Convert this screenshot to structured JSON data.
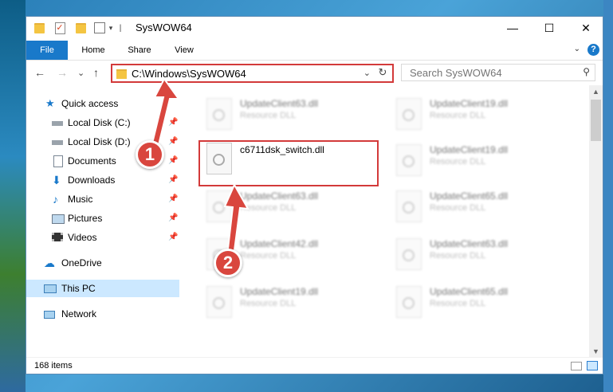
{
  "window": {
    "title": "SysWOW64",
    "minimize": "—",
    "maximize": "☐",
    "close": "✕"
  },
  "ribbon": {
    "tabs": [
      "File",
      "Home",
      "Share",
      "View"
    ],
    "help": "?",
    "expand": "⌄"
  },
  "navbar": {
    "back": "←",
    "forward": "→",
    "recent": "⌄",
    "up": "↑",
    "address": "C:\\Windows\\SysWOW64",
    "address_dropdown": "⌄",
    "refresh": "↻",
    "search_placeholder": "Search SysWOW64",
    "search_icon": "⚲"
  },
  "nav_pane": {
    "items": [
      {
        "label": "Quick access",
        "icon": "star-icon",
        "pinned": false
      },
      {
        "label": "Local Disk (C:)",
        "icon": "drive-icon",
        "pinned": true
      },
      {
        "label": "Local Disk (D:)",
        "icon": "drive-icon",
        "pinned": true
      },
      {
        "label": "Documents",
        "icon": "documents-icon",
        "pinned": true
      },
      {
        "label": "Downloads",
        "icon": "download-icon",
        "pinned": true
      },
      {
        "label": "Music",
        "icon": "music-icon",
        "pinned": true
      },
      {
        "label": "Pictures",
        "icon": "pictures-icon",
        "pinned": true
      },
      {
        "label": "Videos",
        "icon": "videos-icon",
        "pinned": true
      },
      {
        "label": "OneDrive",
        "icon": "cloud-icon",
        "pinned": false
      },
      {
        "label": "This PC",
        "icon": "computer-icon",
        "pinned": false
      },
      {
        "label": "Network",
        "icon": "network-icon",
        "pinned": false
      }
    ],
    "pin_glyph": "📌"
  },
  "files": {
    "highlighted": {
      "name": "c6711dsk_switch.dll"
    },
    "left_column": [
      {
        "name": "UpdateClient63.dll",
        "type": "Resource DLL"
      },
      {
        "name": "UpdateClient63.dll",
        "type": "Resource DLL"
      },
      {
        "name": "UpdateClient42.dll",
        "type": "Resource DLL"
      },
      {
        "name": "UpdateClient19.dll",
        "type": "Resource DLL"
      }
    ],
    "right_column": [
      {
        "name": "UpdateClient19.dll",
        "type": "Resource DLL"
      },
      {
        "name": "UpdateClient19.dll",
        "type": "Resource DLL"
      },
      {
        "name": "UpdateClient65.dll",
        "type": "Resource DLL"
      },
      {
        "name": "UpdateClient63.dll",
        "type": "Resource DLL"
      },
      {
        "name": "UpdateClient65.dll",
        "type": "Resource DLL"
      }
    ]
  },
  "status": {
    "item_count": "168 items"
  },
  "annotations": {
    "step1": "1",
    "step2": "2",
    "color": "#d33a3a"
  },
  "colors": {
    "accent": "#1979ca",
    "selection": "#cce8ff"
  }
}
